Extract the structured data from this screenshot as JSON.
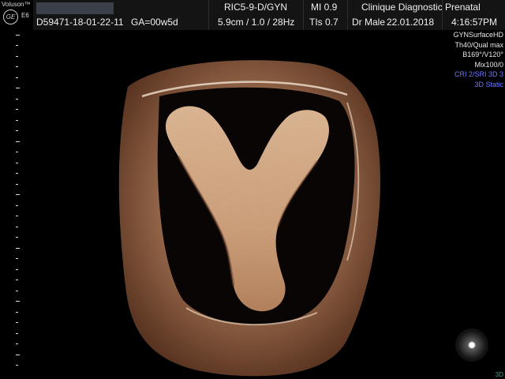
{
  "header": {
    "brand": "Voluson™",
    "logo_text": "GE",
    "model": "E6",
    "patient_id": "D59471-18-01-22-11",
    "ga": "GA=00w5d",
    "probe": "RIC5-9-D/GYN",
    "depth_info": "5.9cm / 1.0 / 28Hz",
    "mi": "MI  0.9",
    "tis": "TIs  0.7",
    "institution": "Clinique Diagnostic Prenatal",
    "operator": "Dr Male",
    "date": "22.01.2018",
    "time": "4:16:57PM"
  },
  "side_info": {
    "lines": [
      {
        "text": "GYNSurfaceHD",
        "color": "#e8e8e8"
      },
      {
        "text": "Th40/Qual max",
        "color": "#e8e8e8"
      },
      {
        "text": "B169°/V120°",
        "color": "#e8e8e8"
      },
      {
        "text": "Mix100/0",
        "color": "#e8e8e8"
      },
      {
        "text": "CRI 2/SRI 3D 3",
        "color": "#6d79ff"
      },
      {
        "text": "3D Static",
        "color": "#6d79ff"
      }
    ]
  },
  "footer": {
    "mode_badge": "3D"
  },
  "colors": {
    "tissue_light": "#d9b08c",
    "tissue_dark": "#7a4a30",
    "accent_blue": "#6d79ff",
    "mode_green": "#3aa57a"
  },
  "icons": {
    "orientation": "orientation-sphere-icon",
    "logo": "ge-logo-icon"
  }
}
